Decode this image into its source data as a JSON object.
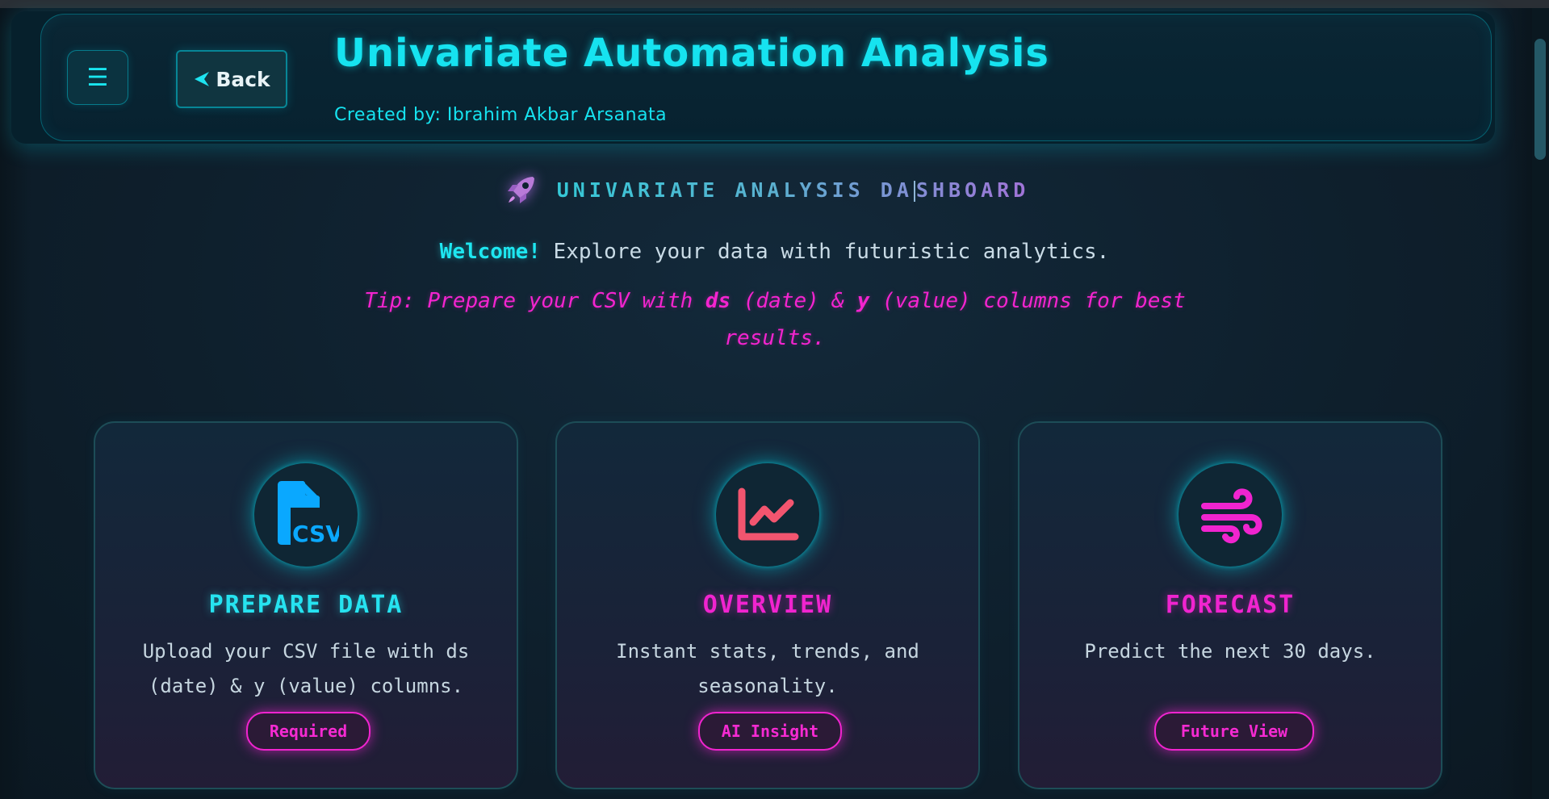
{
  "header": {
    "menu_icon": "☰",
    "back_icon": "➤",
    "back_label": "Back",
    "title": "Univariate Automation Analysis",
    "subtitle": "Created by: Ibrahim Akbar Arsanata"
  },
  "dashboard": {
    "icon": "rocket-icon",
    "heading_part1": "UNIVARIATE ANALYSIS DA",
    "heading_part2": "SHBOARD",
    "welcome_bold": "Welcome!",
    "welcome_rest": " Explore your data with futuristic analytics.",
    "tip_part1": "Tip: Prepare your CSV with ",
    "tip_ds": "ds",
    "tip_part2": " (date) & ",
    "tip_y": "y",
    "tip_part3": " (value) columns for best results."
  },
  "cards": [
    {
      "icon": "csv-file-icon",
      "icon_text": "CSV",
      "title": "PREPARE DATA",
      "description": "Upload your CSV file with ds (date) & y (value) columns.",
      "badge": "Required"
    },
    {
      "icon": "chart-line-icon",
      "title": "OVERVIEW",
      "description": "Instant stats, trends, and seasonality.",
      "badge": "AI Insight"
    },
    {
      "icon": "wind-icon",
      "title": "FORECAST",
      "description": "Predict the next 30 days.",
      "badge": "Future View"
    }
  ],
  "colors": {
    "accent_cyan": "#16e3f0",
    "accent_magenta": "#f024cf",
    "csv_icon_blue": "#0aa8ff",
    "chart_icon_red": "#f2556f",
    "background": "#0d1d28"
  }
}
